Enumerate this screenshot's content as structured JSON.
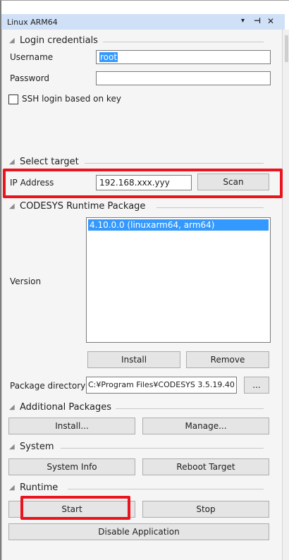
{
  "window": {
    "title": "Linux ARM64",
    "buttons": {
      "menu": "▾",
      "pin": "⊣",
      "close": "✕"
    }
  },
  "login": {
    "heading": "Login credentials",
    "username_label": "Username",
    "username_value": "root",
    "password_label": "Password",
    "password_value": "",
    "ssh_label": "SSH login based on key",
    "ssh_checked": false
  },
  "target": {
    "heading": "Select target",
    "ip_label": "IP Address",
    "ip_value": "192.168.xxx.yyy",
    "scan_label": "Scan"
  },
  "runtime_package": {
    "heading": "CODESYS Runtime Package",
    "version_label": "Version",
    "versions": [
      "4.10.0.0 (linuxarm64, arm64)"
    ],
    "install_label": "Install",
    "remove_label": "Remove",
    "dir_label": "Package directory",
    "dir_value": "C:¥Program Files¥CODESYS 3.5.19.40",
    "browse_label": "..."
  },
  "additional": {
    "heading": "Additional Packages",
    "install_label": "Install...",
    "manage_label": "Manage..."
  },
  "system": {
    "heading": "System",
    "info_label": "System Info",
    "reboot_label": "Reboot Target"
  },
  "runtime": {
    "heading": "Runtime",
    "start_label": "Start",
    "stop_label": "Stop",
    "disable_label": "Disable Application"
  },
  "colors": {
    "highlight": "#e8141e",
    "selection": "#3399ff",
    "titlebar": "#cfe0f7"
  }
}
